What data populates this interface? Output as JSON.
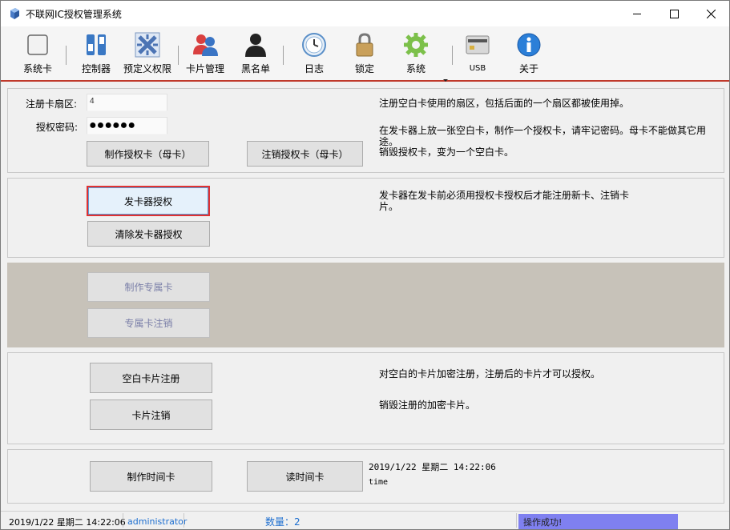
{
  "window": {
    "title": "不联网IC授权管理系统",
    "app_icon": "app-logo-icon",
    "controls": [
      "minimize-icon",
      "maximize-icon",
      "close-icon"
    ]
  },
  "toolbar": {
    "items": [
      {
        "label": "系统卡",
        "icon": "card-icon"
      },
      {
        "label": "控制器",
        "icon": "controller-icon"
      },
      {
        "label": "预定义权限",
        "icon": "permission-icon"
      },
      {
        "label": "卡片管理",
        "icon": "users-icon"
      },
      {
        "label": "黑名单",
        "icon": "blacklist-icon"
      },
      {
        "label": "日志",
        "icon": "log-icon"
      },
      {
        "label": "锁定",
        "icon": "lock-icon"
      },
      {
        "label": "系统",
        "icon": "gear-icon"
      },
      {
        "label": "USB",
        "icon": "usb-card-reader-icon"
      },
      {
        "label": "关于",
        "icon": "info-icon"
      }
    ],
    "accent_color": "#c0392b"
  },
  "system_card": {
    "sector_label": "注册卡扇区:",
    "sector_value": "4",
    "password_label": "授权密码:",
    "password_value": "●●●●●●",
    "make_button": "制作授权卡（母卡）",
    "revoke_button": "注销授权卡（母卡）",
    "desc1": "注册空白卡使用的扇区，包括后面的一个扇区都被使用掉。",
    "desc2": "在发卡器上放一张空白卡，制作一个授权卡，请牢记密码。母卡不能做其它用途。",
    "desc3": "销毁授权卡，变为一个空白卡。"
  },
  "issuer": {
    "authorize_button": "发卡器授权",
    "clear_button": "清除发卡器授权",
    "desc": "发卡器在发卡前必须用授权卡授权后才能注册新卡、注销卡片。"
  },
  "exclusive": {
    "make_button": "制作专属卡",
    "revoke_button": "专属卡注销"
  },
  "card_register": {
    "register_button": "空白卡片注册",
    "revoke_button": "卡片注销",
    "desc1": "对空白的卡片加密注册，注册后的卡片才可以授权。",
    "desc2": "销毁注册的加密卡片。"
  },
  "time_card": {
    "make_button": "制作时间卡",
    "read_button": "读时间卡",
    "time_value": "2019/1/22 星期二 14:22:06",
    "time_label": "time"
  },
  "statusbar": {
    "datetime": "2019/1/22 星期二 14:22:06",
    "user": "administrator",
    "count_label": "数量：2",
    "status": "操作成功!",
    "user_color": "#1e6fd0",
    "count_color": "#1e6fd0",
    "status_bg": "#7f80f0"
  }
}
